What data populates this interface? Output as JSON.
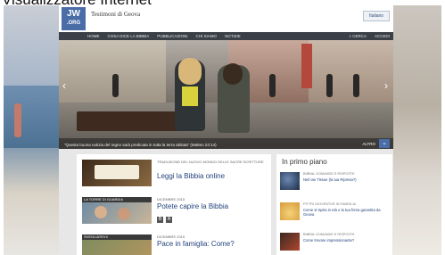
{
  "window": {
    "title": "Visualizzatore Internet"
  },
  "site": {
    "logo_line1": "JW",
    "logo_line2": ".ORG",
    "name": "Testimoni di Geova",
    "language_button": "Italiano"
  },
  "nav": {
    "items": [
      "HOME",
      "COSA DICE LA BIBBIA",
      "PUBBLICAZIONI",
      "CHI SIAMO",
      "NOTIZIE"
    ],
    "search_label": "CERCA",
    "login_label": "ACCEDI"
  },
  "hero": {
    "caption": "“Questa buona notizia del regno sarà predicata in tutta la terra abitata” (Matteo 24:14)",
    "more_label": "ALTRO",
    "prev_icon": "‹",
    "next_icon": "›",
    "down_icon": "⌄"
  },
  "articles": [
    {
      "meta": "TRADUZIONE DEL NUOVO MONDO DELLE SACRE SCRITTURE",
      "title": "Leggi la Bibbia online"
    },
    {
      "thumb_label": "LA TORRE DI GUARDIA",
      "meta": "DICEMBRE 2015",
      "title": "Potete capire la Bibbia",
      "icon_labels": [
        "B",
        "A"
      ]
    },
    {
      "thumb_label": "SVEGLIATEVI!",
      "meta": "DICEMBRE 2015",
      "title": "Pace in famiglia: Come?"
    }
  ],
  "sidebar": {
    "title": "In primo piano",
    "items": [
      {
        "label": "BIBBIA: DOMANDE E RISPOSTE",
        "text": "Neil Ian Tissue (la tua Ripresa?)"
      },
      {
        "label": "PITTRI GIOVENTUR IN FAMIGLIA",
        "text": "Come si ispira in età e la tua forza garantita da Geova"
      },
      {
        "label": "BIBBIA: DOMANDE E RISPOSTE",
        "text": "Come trovare impressionante?"
      }
    ]
  }
}
